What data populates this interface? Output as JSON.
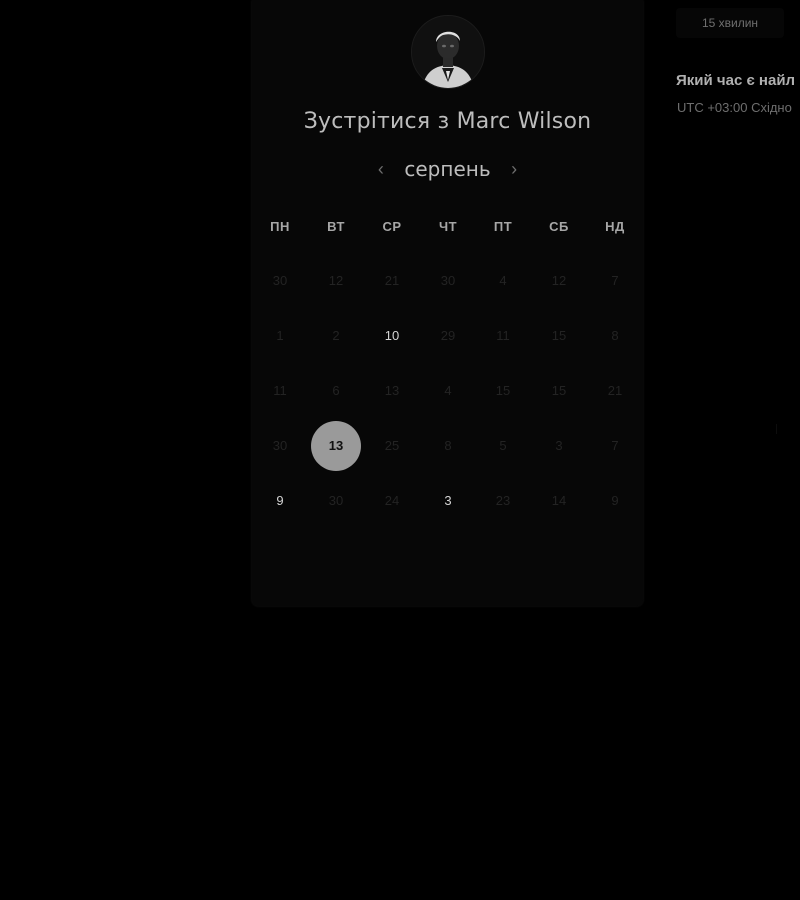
{
  "card": {
    "title": "Зустрітися з Marc Wilson",
    "month": "серпень",
    "prev_icon": "chevron-left-icon",
    "next_icon": "chevron-right-icon",
    "prev_glyph": "‹",
    "next_glyph": "›"
  },
  "weekdays": [
    "ПН",
    "ВТ",
    "СР",
    "ЧТ",
    "ПТ",
    "СБ",
    "НД"
  ],
  "weeks": [
    [
      {
        "d": "30",
        "a": false
      },
      {
        "d": "12",
        "a": false
      },
      {
        "d": "21",
        "a": false
      },
      {
        "d": "30",
        "a": false
      },
      {
        "d": "4",
        "a": false
      },
      {
        "d": "12",
        "a": false
      },
      {
        "d": "7",
        "a": false
      }
    ],
    [
      {
        "d": "1",
        "a": false
      },
      {
        "d": "2",
        "a": false
      },
      {
        "d": "10",
        "a": true
      },
      {
        "d": "29",
        "a": false
      },
      {
        "d": "11",
        "a": false
      },
      {
        "d": "15",
        "a": false
      },
      {
        "d": "8",
        "a": false
      }
    ],
    [
      {
        "d": "11",
        "a": false
      },
      {
        "d": "6",
        "a": false
      },
      {
        "d": "13",
        "a": false
      },
      {
        "d": "4",
        "a": false
      },
      {
        "d": "15",
        "a": false
      },
      {
        "d": "15",
        "a": false
      },
      {
        "d": "21",
        "a": false
      }
    ],
    [
      {
        "d": "30",
        "a": false
      },
      {
        "d": "13",
        "a": true,
        "selected": true
      },
      {
        "d": "25",
        "a": false
      },
      {
        "d": "8",
        "a": false
      },
      {
        "d": "5",
        "a": false
      },
      {
        "d": "3",
        "a": false
      },
      {
        "d": "7",
        "a": false
      }
    ],
    [
      {
        "d": "9",
        "a": true
      },
      {
        "d": "30",
        "a": false
      },
      {
        "d": "24",
        "a": false
      },
      {
        "d": "3",
        "a": true
      },
      {
        "d": "23",
        "a": false
      },
      {
        "d": "14",
        "a": false
      },
      {
        "d": "9",
        "a": false
      }
    ]
  ],
  "side": {
    "duration": "15 хвилин",
    "question": "Який час є найл",
    "timezone": "UTC +03:00 Східно"
  },
  "colors": {
    "background": "#000000",
    "card": "#070707",
    "selected_day": "#9a9a9a",
    "available_day_text": "#d4d4d4",
    "unavailable_day_text": "#232323"
  }
}
